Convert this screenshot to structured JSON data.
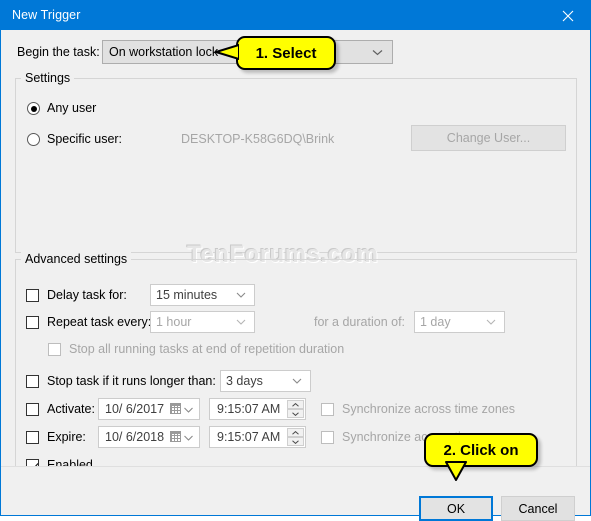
{
  "window": {
    "title": "New Trigger",
    "close_icon": "close-icon",
    "accent_color": "#0078d7"
  },
  "begin": {
    "label": "Begin the task:",
    "value": "On workstation lock"
  },
  "settings": {
    "title": "Settings",
    "any_user_label": "Any user",
    "any_user_checked": true,
    "specific_user_label": "Specific user:",
    "specific_user_checked": false,
    "specific_user_value": "DESKTOP-K58G6DQ\\Brink",
    "change_user_label": "Change User..."
  },
  "advanced": {
    "title": "Advanced settings",
    "delay": {
      "label": "Delay task for:",
      "checked": false,
      "value": "15 minutes"
    },
    "repeat": {
      "label": "Repeat task every:",
      "checked": false,
      "value": "1 hour",
      "duration_label": "for a duration of:",
      "duration_value": "1 day"
    },
    "stop_all": {
      "label": "Stop all running tasks at end of repetition duration",
      "checked": false
    },
    "stop_longer": {
      "label": "Stop task if it runs longer than:",
      "checked": false,
      "value": "3 days"
    },
    "activate": {
      "label": "Activate:",
      "checked": false,
      "date": "10/  6/2017",
      "time": "9:15:07 AM",
      "sync_label": "Synchronize across time zones",
      "sync_checked": false
    },
    "expire": {
      "label": "Expire:",
      "checked": false,
      "date": "10/  6/2018",
      "time": "9:15:07 AM",
      "sync_label": "Synchronize across time zones",
      "sync_checked": false
    },
    "enabled": {
      "label": "Enabled",
      "checked": true
    }
  },
  "watermark": "TenForums.com",
  "footer": {
    "ok_label": "OK",
    "cancel_label": "Cancel"
  },
  "callouts": {
    "select": "1. Select",
    "click": "2. Click on"
  }
}
